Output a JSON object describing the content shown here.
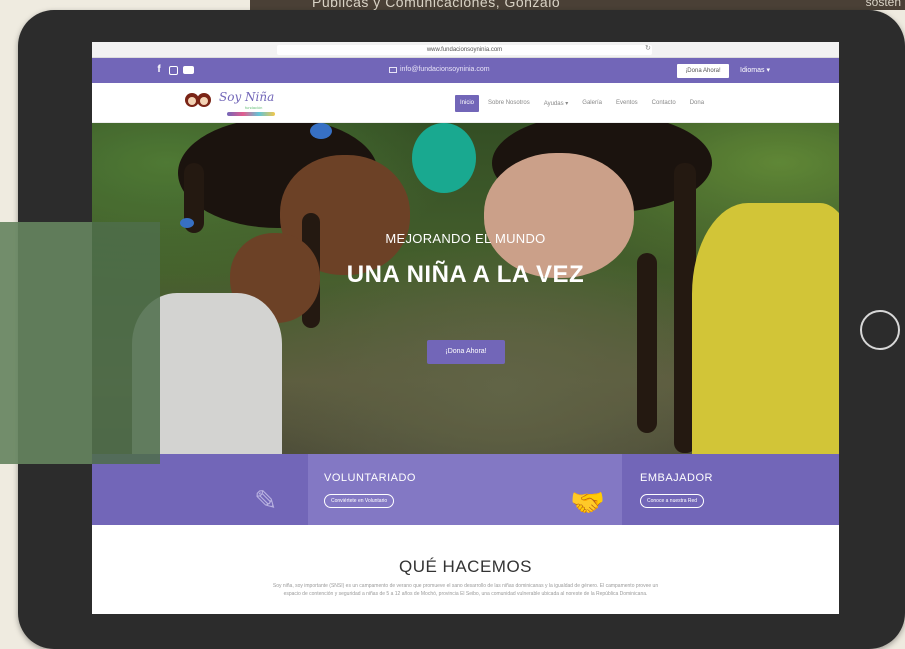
{
  "background_caption": {
    "text": "Públicas y Comunicaciones, Gonzalo",
    "right_text": "sosten"
  },
  "browser": {
    "url": "www.fundacionsoyninia.com",
    "reload_icon": "reload-icon"
  },
  "topbar": {
    "social_icons": [
      "facebook-icon",
      "instagram-icon",
      "youtube-icon"
    ],
    "email": "info@fundacionsoyninia.com",
    "donate_button": "¡Dona Ahora!",
    "language": "Idiomas ▾",
    "accent_color": "#7266b8"
  },
  "navbar": {
    "logo_text": "Soy Niña",
    "logo_sub": "fundación",
    "items": [
      "Inicio",
      "Sobre Nosotros",
      "Ayudas ▾",
      "Galería",
      "Eventos",
      "Contacto",
      "Dona"
    ],
    "active_index": 0
  },
  "hero": {
    "subtitle": "MEJORANDO EL MUNDO",
    "title": "UNA NIÑA A LA VEZ",
    "button": "¡Dona Ahora!"
  },
  "bands": {
    "voluntariado": {
      "title": "VOLUNTARIADO",
      "button": "Conviértete en Voluntario",
      "icon": "handshake-icon"
    },
    "embajador": {
      "title": "EMBAJADOR",
      "button": "Conoce a nuestra Red",
      "icon": "ribbon-icon"
    },
    "first_icon": "pencil-icon"
  },
  "section": {
    "title": "QUÉ HACEMOS",
    "text": "Soy niña, soy importante (SNSI) es un campamento de verano que promueve el sano desarrollo de las niñas dominicanas y la igualdad de género. El campamento provee un espacio de contención y seguridad a niñas de 5 a 12 años de Mochó, provincia El Seibo, una comunidad vulnerable ubicada al noreste de la República Dominicana."
  }
}
